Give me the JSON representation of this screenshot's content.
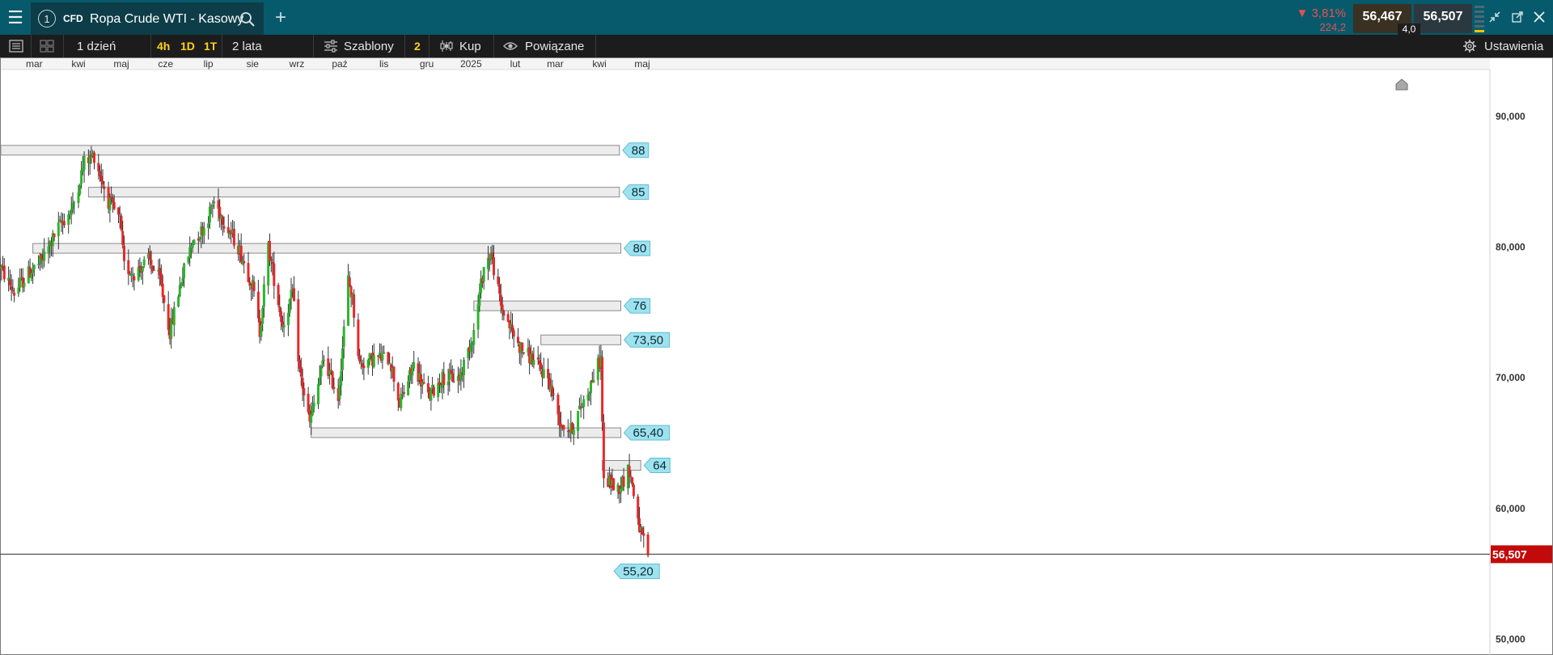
{
  "app": {
    "product_type": "CFD",
    "instrument_title": "Ropa Crude WTI - Kasowy",
    "tab_number": "1",
    "change_pct": "▼ 3,81%",
    "change_abs": "224,2",
    "sell_price": "56,467",
    "buy_price": "56,507",
    "spread": "4,0"
  },
  "toolbar": {
    "interval": "1 dzień",
    "quick_4h": "4h",
    "quick_1d": "1D",
    "quick_1t": "1T",
    "range": "2 lata",
    "templates": "Szablony",
    "templates_count": "2",
    "buy": "Kup",
    "related": "Powiązane",
    "settings": "Ustawienia"
  },
  "colors": {
    "titlebar": "#075a6c",
    "toolbar": "#1c1c1c",
    "up_candle": "#2db52d",
    "down_candle": "#e8292b",
    "level_marker": "#9fe2ef",
    "price_tag": "#c30a0a"
  },
  "chart_data": {
    "type": "candlestick",
    "instrument": "Ropa Crude WTI - Kasowy",
    "interval": "1 dzień",
    "x_axis_labels": [
      "mar",
      "kwi",
      "maj",
      "cze",
      "lip",
      "sie",
      "wrz",
      "paź",
      "lis",
      "gru",
      "2025",
      "lut",
      "mar",
      "kwi",
      "maj"
    ],
    "y_axis": {
      "ticks": [
        "90,000",
        "80,000",
        "70,000",
        "60,000",
        "50,000"
      ],
      "tick_values": [
        90,
        80,
        70,
        60,
        50
      ],
      "range": [
        48.8,
        94.5
      ]
    },
    "current_price": {
      "label": "56,507",
      "value": 56.507
    },
    "levels": [
      {
        "label": "88",
        "value": 87.4,
        "start": "2024-02-06",
        "end": "2025-04-15"
      },
      {
        "label": "85",
        "value": 84.2,
        "start": "2024-04-08",
        "end": "2025-04-15"
      },
      {
        "label": "80",
        "value": 79.9,
        "start": "2024-02-29",
        "end": "2025-04-16"
      },
      {
        "label": "76",
        "value": 75.5,
        "start": "2025-01-03",
        "end": "2025-04-16"
      },
      {
        "label": "73,50",
        "value": 72.9,
        "start": "2025-02-19",
        "end": "2025-04-16"
      },
      {
        "label": "65,40",
        "value": 65.8,
        "start": "2024-09-11",
        "end": "2025-04-16"
      },
      {
        "label": "64",
        "value": 63.3,
        "start": "2025-04-03",
        "end": "2025-04-30"
      },
      {
        "label": "55,20",
        "value": 55.2,
        "start": "2025-04-09",
        "end": "2025-04-09"
      }
    ],
    "close_path": [
      [
        "2024-02-06",
        78.5
      ],
      [
        "2024-02-16",
        76.5
      ],
      [
        "2024-02-26",
        78.0
      ],
      [
        "2024-03-06",
        78.9
      ],
      [
        "2024-03-18",
        81.5
      ],
      [
        "2024-03-28",
        83.0
      ],
      [
        "2024-04-05",
        86.5
      ],
      [
        "2024-04-12",
        87.0
      ],
      [
        "2024-04-22",
        83.5
      ],
      [
        "2024-04-30",
        82.0
      ],
      [
        "2024-05-03",
        78.5
      ],
      [
        "2024-05-10",
        78.0
      ],
      [
        "2024-05-20",
        79.0
      ],
      [
        "2024-05-28",
        77.5
      ],
      [
        "2024-06-04",
        73.5
      ],
      [
        "2024-06-12",
        77.5
      ],
      [
        "2024-06-20",
        80.5
      ],
      [
        "2024-06-28",
        81.5
      ],
      [
        "2024-07-05",
        83.5
      ],
      [
        "2024-07-12",
        82.0
      ],
      [
        "2024-07-22",
        80.0
      ],
      [
        "2024-08-01",
        77.0
      ],
      [
        "2024-08-06",
        73.5
      ],
      [
        "2024-08-12",
        80.0
      ],
      [
        "2024-08-22",
        74.0
      ],
      [
        "2024-08-29",
        76.5
      ],
      [
        "2024-09-03",
        70.5
      ],
      [
        "2024-09-10",
        66.5
      ],
      [
        "2024-09-20",
        71.5
      ],
      [
        "2024-09-30",
        68.5
      ],
      [
        "2024-10-07",
        77.5
      ],
      [
        "2024-10-10",
        76.0
      ],
      [
        "2024-10-15",
        71.0
      ],
      [
        "2024-10-25",
        71.5
      ],
      [
        "2024-11-05",
        71.5
      ],
      [
        "2024-11-12",
        68.0
      ],
      [
        "2024-11-22",
        71.0
      ],
      [
        "2024-12-02",
        68.5
      ],
      [
        "2024-12-12",
        70.0
      ],
      [
        "2024-12-24",
        70.0
      ],
      [
        "2025-01-03",
        73.5
      ],
      [
        "2025-01-10",
        78.5
      ],
      [
        "2025-01-15",
        79.5
      ],
      [
        "2025-01-22",
        75.5
      ],
      [
        "2025-02-03",
        72.5
      ],
      [
        "2025-02-12",
        71.5
      ],
      [
        "2025-02-24",
        70.0
      ],
      [
        "2025-03-05",
        66.5
      ],
      [
        "2025-03-12",
        66.0
      ],
      [
        "2025-03-24",
        69.0
      ],
      [
        "2025-04-02",
        71.5
      ],
      [
        "2025-04-04",
        62.0
      ],
      [
        "2025-04-09",
        62.0
      ],
      [
        "2025-04-14",
        61.5
      ],
      [
        "2025-04-22",
        63.0
      ],
      [
        "2025-04-30",
        58.0
      ],
      [
        "2025-05-05",
        56.5
      ]
    ]
  }
}
